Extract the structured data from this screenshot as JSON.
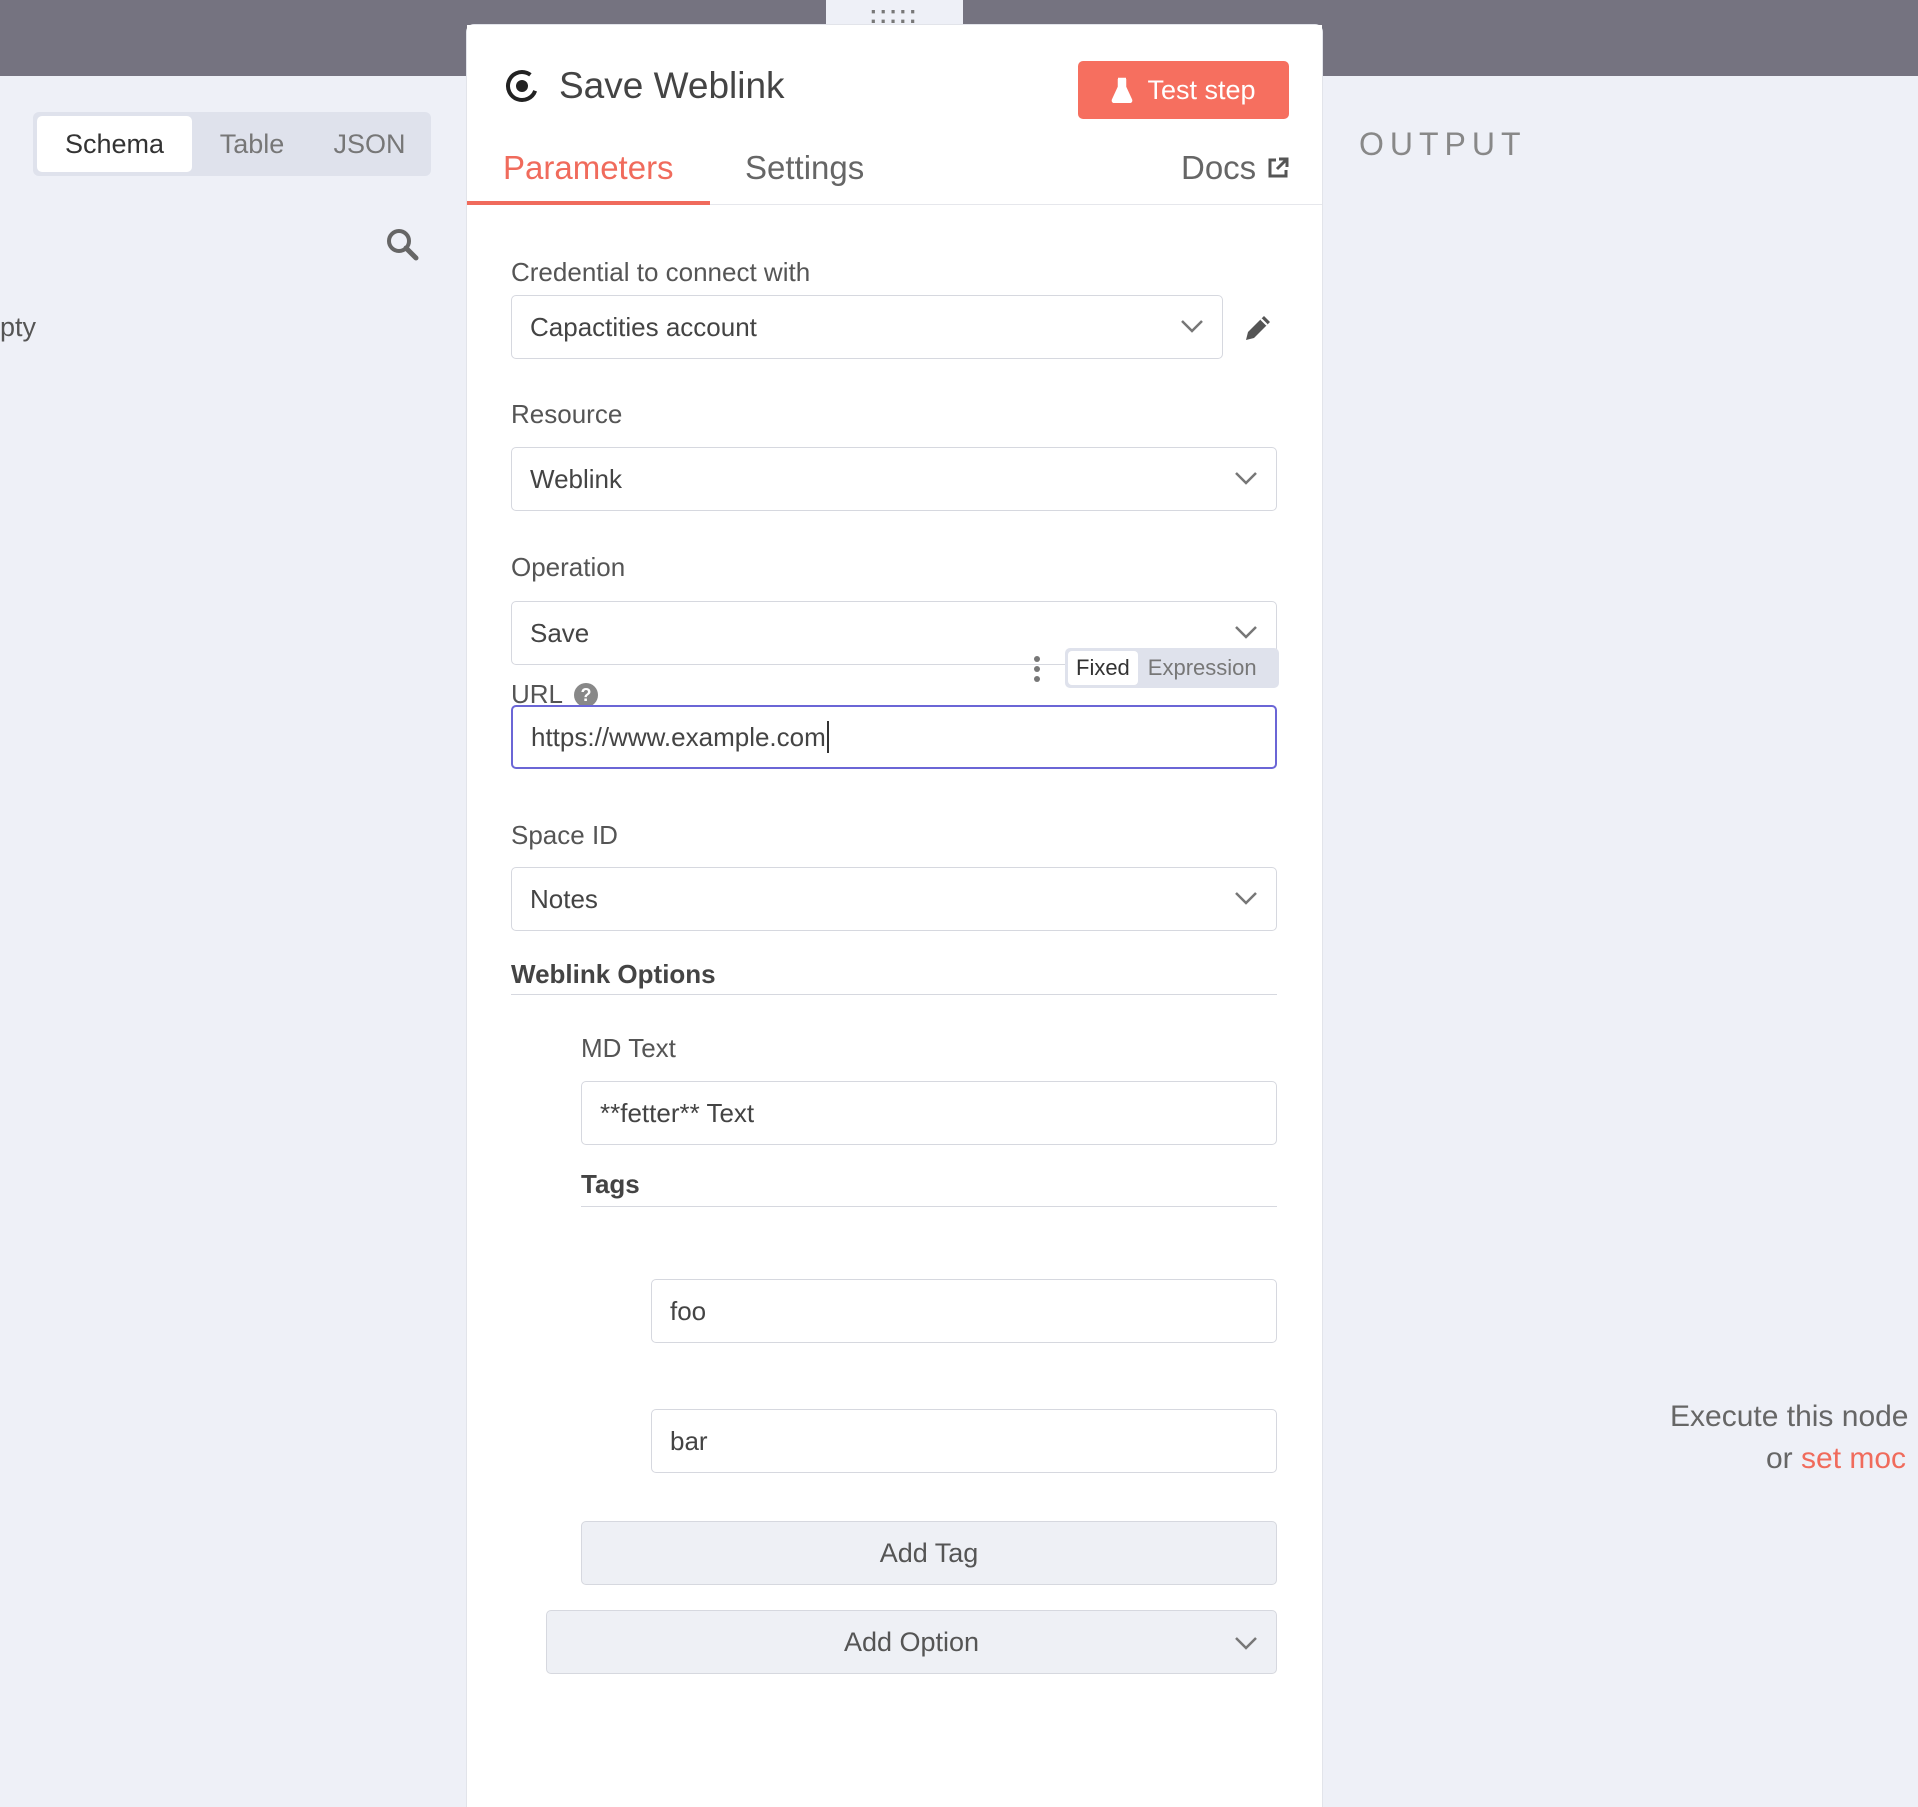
{
  "left_panel": {
    "tabs": [
      {
        "label": "Schema",
        "active": true
      },
      {
        "label": "Table",
        "active": false
      },
      {
        "label": "JSON",
        "active": false
      }
    ],
    "empty_fragment": "pty"
  },
  "output_panel": {
    "title": "OUTPUT",
    "message_line1": "Execute this node",
    "message_line2_prefix": "or ",
    "message_line2_link": "set moc"
  },
  "node": {
    "title": "Save Weblink",
    "test_button": "Test step",
    "tabs": {
      "parameters": "Parameters",
      "settings": "Settings",
      "docs": "Docs"
    }
  },
  "form": {
    "credential": {
      "label": "Credential to connect with",
      "value": "Capactities account"
    },
    "resource": {
      "label": "Resource",
      "value": "Weblink"
    },
    "operation": {
      "label": "Operation",
      "value": "Save"
    },
    "url": {
      "label": "URL",
      "value": "https://www.example.com",
      "mode_fixed": "Fixed",
      "mode_expression": "Expression"
    },
    "space_id": {
      "label": "Space ID",
      "value": "Notes"
    },
    "weblink_options": {
      "title": "Weblink Options",
      "md_text": {
        "label": "MD Text",
        "value": "**fetter** Text"
      },
      "tags": {
        "title": "Tags",
        "values": [
          "foo",
          "bar"
        ],
        "add_button": "Add Tag"
      },
      "add_option": "Add Option"
    }
  },
  "colors": {
    "accent": "#f06b5c",
    "focus": "#6b66d6",
    "topbar": "#757380"
  }
}
